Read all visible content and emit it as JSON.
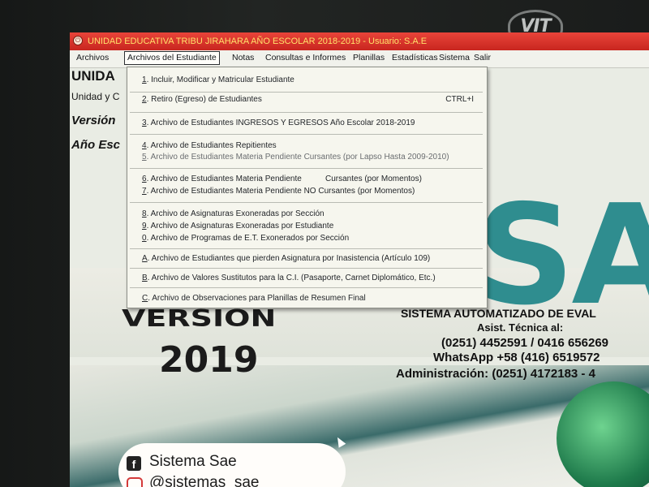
{
  "window": {
    "title": "UNIDAD EDUCATIVA TRIBU JIRAHARA AÑO ESCOLAR 2018-2019 - Usuario: S.A.E"
  },
  "monitor_brand": "VIT",
  "menubar": {
    "items": [
      {
        "label": "Archivos"
      },
      {
        "label": "Archivos del Estudiante"
      },
      {
        "label": "Notas"
      },
      {
        "label": "Consultas e Informes"
      },
      {
        "label": "Planillas"
      },
      {
        "label": "Estadísticas"
      },
      {
        "label": "Sistema"
      },
      {
        "label": "Salir"
      }
    ]
  },
  "dropdown": {
    "items": [
      {
        "key": "1",
        "label": ". Incluir, Modificar y Matricular Estudiante"
      },
      {
        "key": "2",
        "label": ". Retiro (Egreso) de Estudiantes",
        "shortcut": "CTRL+I"
      },
      {
        "key": "3",
        "label": ". Archivo de Estudiantes INGRESOS Y EGRESOS Año Escolar 2018-2019"
      },
      {
        "key": "4",
        "label": ". Archivo de Estudiantes Repitientes"
      },
      {
        "key": "5",
        "label": ". Archivo de Estudiantes Materia Pendiente Cursantes (por Lapso Hasta 2009-2010)"
      },
      {
        "key": "6",
        "label": ". Archivo de Estudiantes Materia Pendiente",
        "extra": "Cursantes (por Momentos)"
      },
      {
        "key": "7",
        "label": ". Archivo de Estudiantes Materia Pendiente NO Cursantes (por Momentos)"
      },
      {
        "key": "8",
        "label": ". Archivo de Asignaturas Exoneradas por Sección"
      },
      {
        "key": "9",
        "label": ". Archivo de Asignaturas Exoneradas por Estudiante"
      },
      {
        "key": "0",
        "label": ". Archivo de Programas de E.T. Exonerados por Sección"
      },
      {
        "key": "A",
        "label": ". Archivo de Estudiantes que pierden Asignatura por Inasistencia (Artículo 109)"
      },
      {
        "key": "B",
        "label": ". Archivo de Valores Sustitutos para la C.I. (Pasaporte, Carnet Diplomático, Etc.)"
      },
      {
        "key": "C",
        "label": ". Archivo de Observaciones para Planillas de Resumen Final"
      }
    ]
  },
  "background": {
    "left_labels": [
      "UNIDA",
      "Unidad y C",
      "Versión",
      "Año Esc"
    ],
    "logo_text": "SAE",
    "big_title_1": "VERSION",
    "big_title_2": "2019",
    "system_name": "SISTEMA AUTOMATIZADO DE EVAL",
    "asist_label": "Asist. Técnica al:",
    "phones": "(0251) 4452591 / 0416 656269",
    "whatsapp": "WhatsApp +58 (416) 6519572",
    "admin": "Administración: (0251) 4172183 - 4",
    "social_fb": "Sistema Sae",
    "social_ig": "@sistemas_sae"
  },
  "colors": {
    "titlebar": "#d52f25",
    "title_text": "#ffe16a",
    "logo_teal": "#2f8d8f",
    "menu_bg": "#f6f6ee"
  }
}
